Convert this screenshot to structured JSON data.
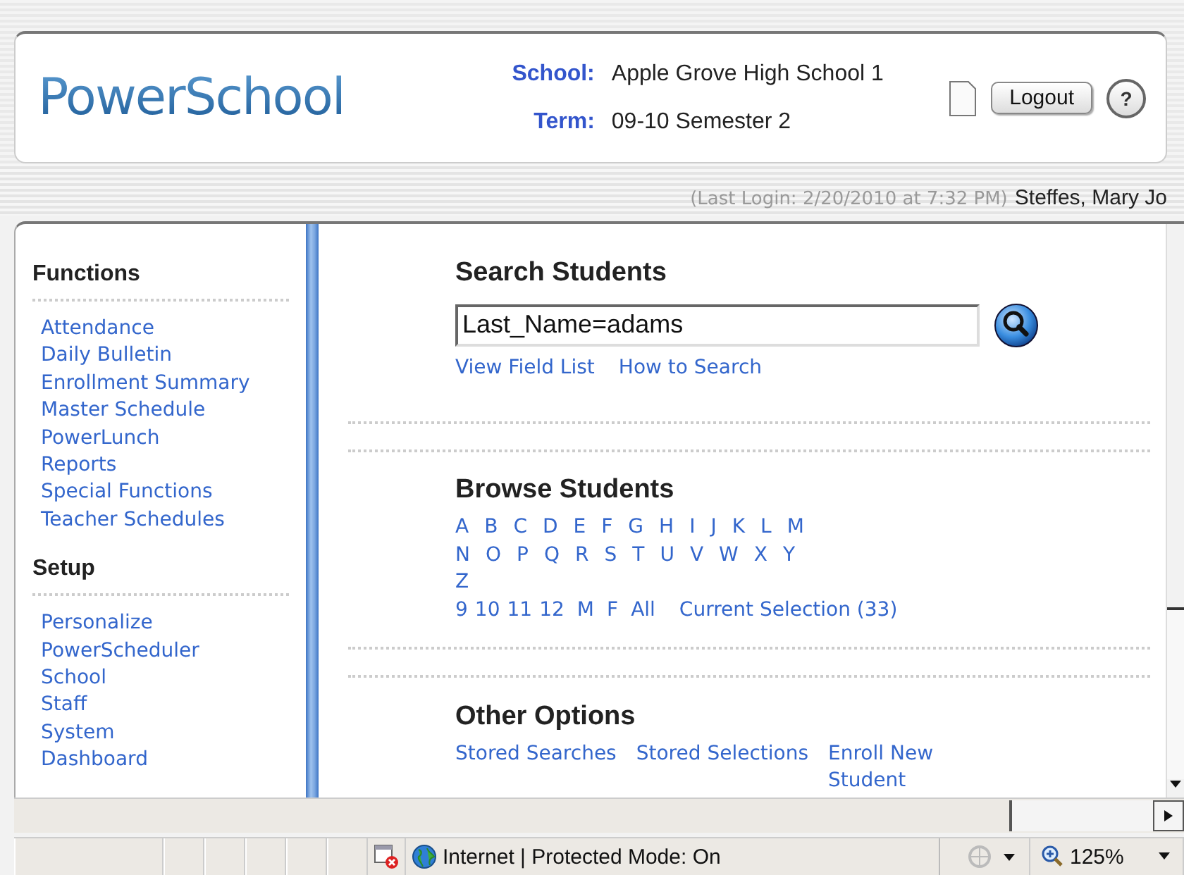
{
  "header": {
    "logo": "PowerSchool",
    "school_label": "School:",
    "school": "Apple Grove High School 1",
    "term_label": "Term:",
    "term": "09-10 Semester 2",
    "logout": "Logout",
    "help": "?"
  },
  "login_bar": {
    "last_login": "(Last Login: 2/20/2010 at 7:32 PM)",
    "user": "Steffes, Mary Jo"
  },
  "sidebar": {
    "sections": [
      {
        "title": "Functions",
        "items": [
          "Attendance",
          "Daily Bulletin",
          "Enrollment Summary",
          "Master Schedule",
          "PowerLunch",
          "Reports",
          "Special Functions",
          "Teacher Schedules"
        ]
      },
      {
        "title": "Setup",
        "items": [
          "Personalize",
          "PowerScheduler",
          "School",
          "Staff",
          "System",
          "Dashboard"
        ]
      }
    ]
  },
  "search": {
    "title": "Search Students",
    "value": "Last_Name=adams",
    "links": [
      "View Field List",
      "How to Search"
    ]
  },
  "browse": {
    "title": "Browse Students",
    "letters": [
      "A",
      "B",
      "C",
      "D",
      "E",
      "F",
      "G",
      "H",
      "I",
      "J",
      "K",
      "L",
      "M",
      "N",
      "O",
      "P",
      "Q",
      "R",
      "S",
      "T",
      "U",
      "V",
      "W",
      "X",
      "Y",
      "Z"
    ],
    "filters": [
      "9",
      "10",
      "11",
      "12",
      "M",
      "F",
      "All"
    ],
    "current_selection": "Current Selection (33)"
  },
  "other": {
    "title": "Other Options",
    "links": [
      "Stored Searches",
      "Stored Selections",
      "Enroll New Student"
    ]
  },
  "status_bar": {
    "zone": "Internet | Protected Mode: On",
    "zoom": "125%"
  }
}
